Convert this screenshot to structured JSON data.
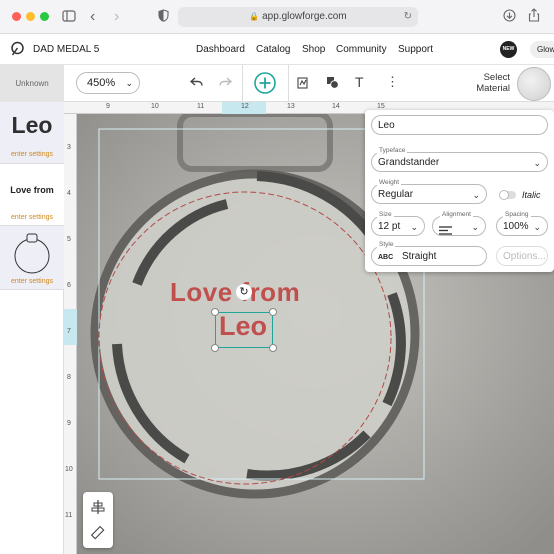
{
  "browser": {
    "url": "app.glowforge.com"
  },
  "header": {
    "project_title": "DAD MEDAL 5",
    "nav": [
      "Dashboard",
      "Catalog",
      "Shop",
      "Community",
      "Support"
    ],
    "new_badge": "NEW",
    "user_label": "Glow"
  },
  "left_panel": {
    "material": "Unknown",
    "thumbs": [
      {
        "preview": "Leo",
        "label": "enter settings"
      },
      {
        "preview": "Love from",
        "label": "enter settings"
      },
      {
        "label": "enter settings"
      }
    ]
  },
  "toolbar": {
    "zoom": "450%",
    "select_material": "Select Material"
  },
  "rulers": {
    "top": [
      "9",
      "10",
      "11",
      "12",
      "13",
      "14",
      "15"
    ],
    "left": [
      "3",
      "4",
      "5",
      "6",
      "7",
      "8",
      "9",
      "10",
      "11"
    ]
  },
  "canvas": {
    "text_line1": "Love from",
    "text_line2": "Leo"
  },
  "properties": {
    "text_value": "Leo",
    "typeface_label": "Typeface",
    "typeface": "Grandstander",
    "weight_label": "Weight",
    "weight": "Regular",
    "italic": "Italic",
    "size_label": "Size",
    "size": "12 pt",
    "alignment_label": "Alignment",
    "spacing_label": "Spacing",
    "spacing": "100%",
    "style_label": "Style",
    "style_icon_text": "ABC",
    "style": "Straight",
    "options": "Options..."
  },
  "colors": {
    "accent": "#1ea89a",
    "engrave_red": "#c0504d",
    "thumb_label": "#d08a1e"
  }
}
